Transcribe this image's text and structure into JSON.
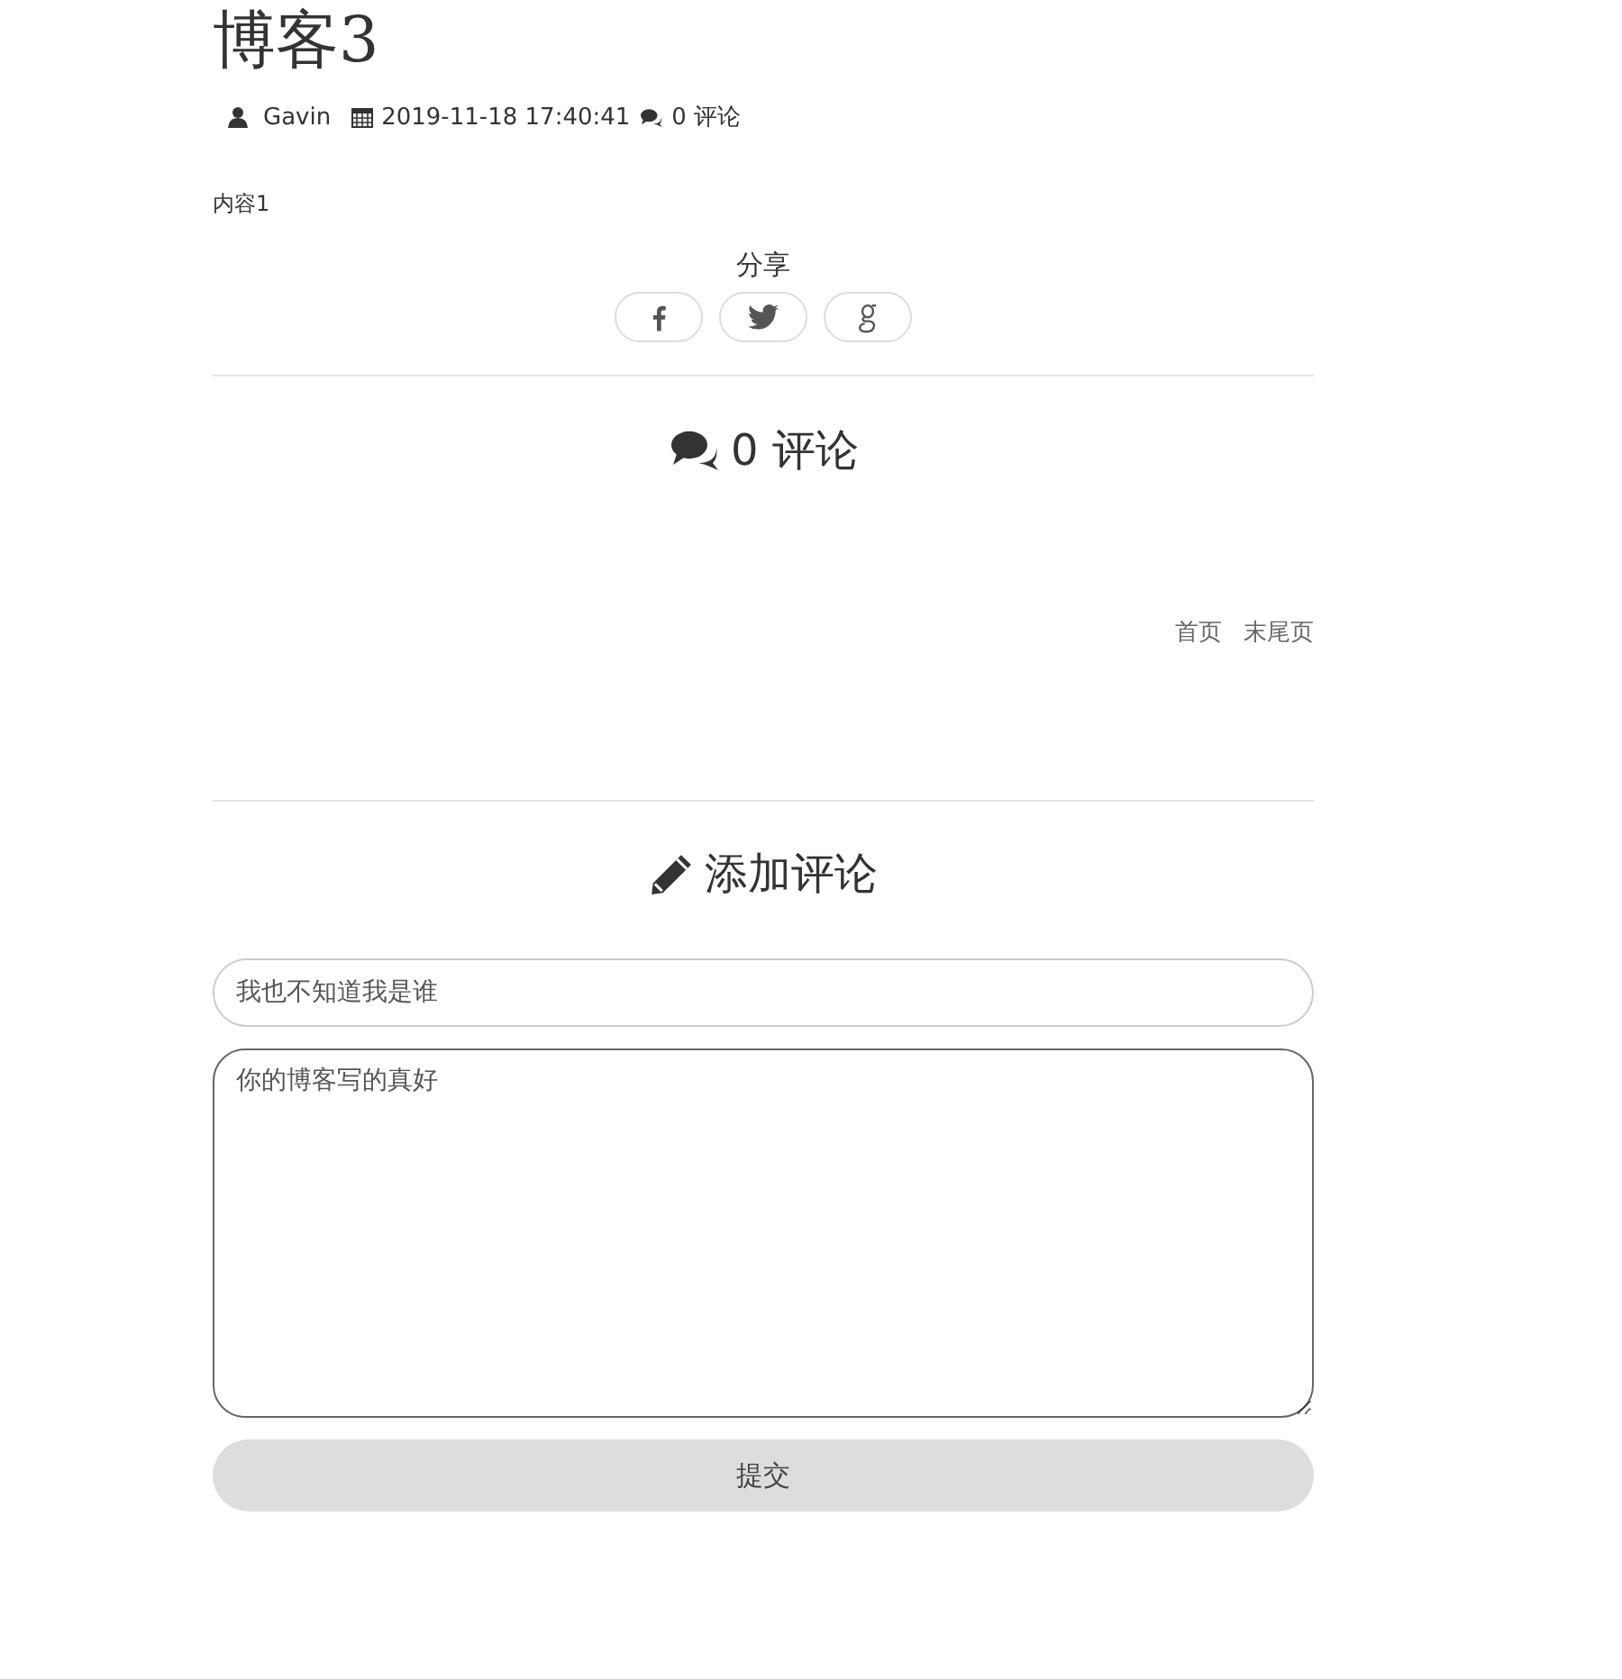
{
  "post": {
    "title": "博客3",
    "author": "Gavin",
    "date": "2019-11-18 17:40:41",
    "comment_count": "0 评论",
    "content": "内容1"
  },
  "share": {
    "label": "分享",
    "buttons": [
      {
        "kind": "facebook"
      },
      {
        "kind": "twitter"
      },
      {
        "kind": "google"
      }
    ]
  },
  "comments": {
    "heading": "0 评论",
    "pagination": [
      "首页",
      "末尾页"
    ]
  },
  "form": {
    "heading": "添加评论",
    "name_value": "我也不知道我是谁",
    "message_value": "你的博客写的真好",
    "submit": "提交"
  }
}
